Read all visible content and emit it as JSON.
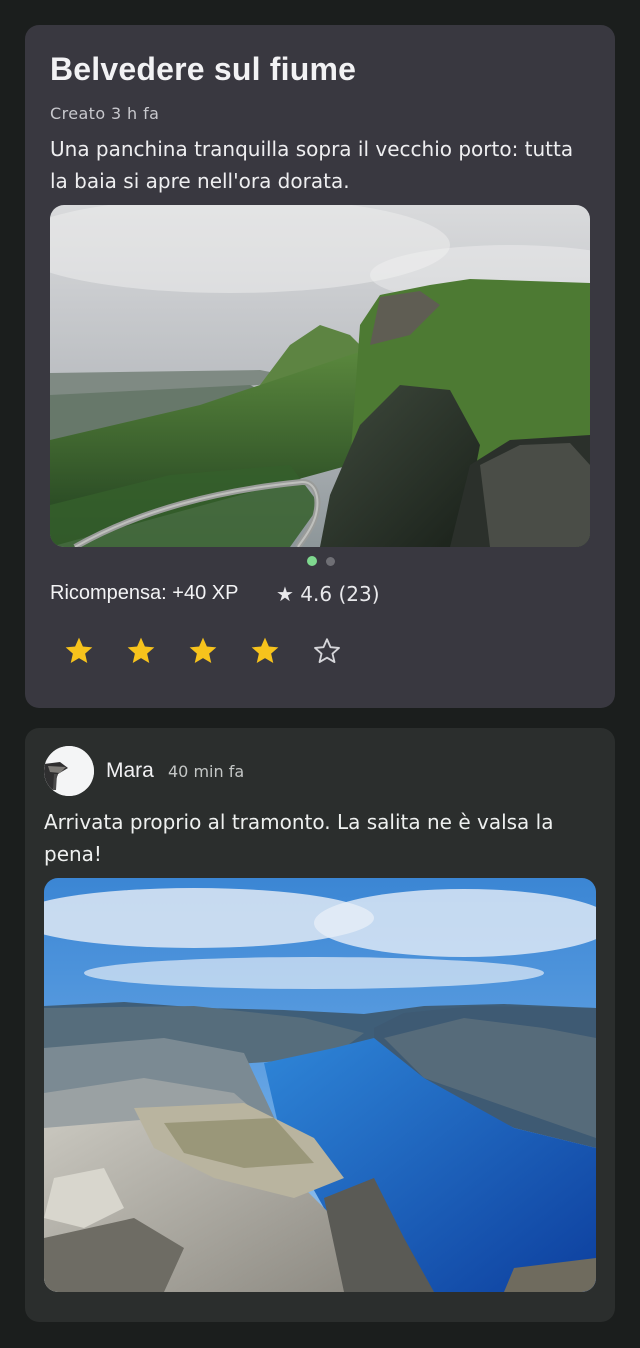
{
  "place": {
    "title": "Belvedere sul fiume",
    "created": "Creato 3 h fa",
    "description": "Una panchina tranquilla sopra il vecchio porto: tutta la baia si apre nell'ora dorata.",
    "carousel": {
      "count": 2,
      "active_index": 0,
      "active_color": "#7fd88f"
    },
    "reward": "Ricompensa: +40 XP",
    "rating": "★ 4.6 (23)",
    "user_rating": {
      "value": 4,
      "max": 5,
      "color": "#f7c31c"
    }
  },
  "post": {
    "author": "Mara",
    "time": "40 min fa",
    "text": "Arrivata proprio al tramonto. La salita ne è valsa la pena!"
  },
  "colors": {
    "background": "#1b1e1d",
    "card_primary": "#393840",
    "card_secondary": "#2b2e2d"
  },
  "icons": {
    "filled_star": "star-filled-icon",
    "empty_star": "star-outline-icon"
  }
}
